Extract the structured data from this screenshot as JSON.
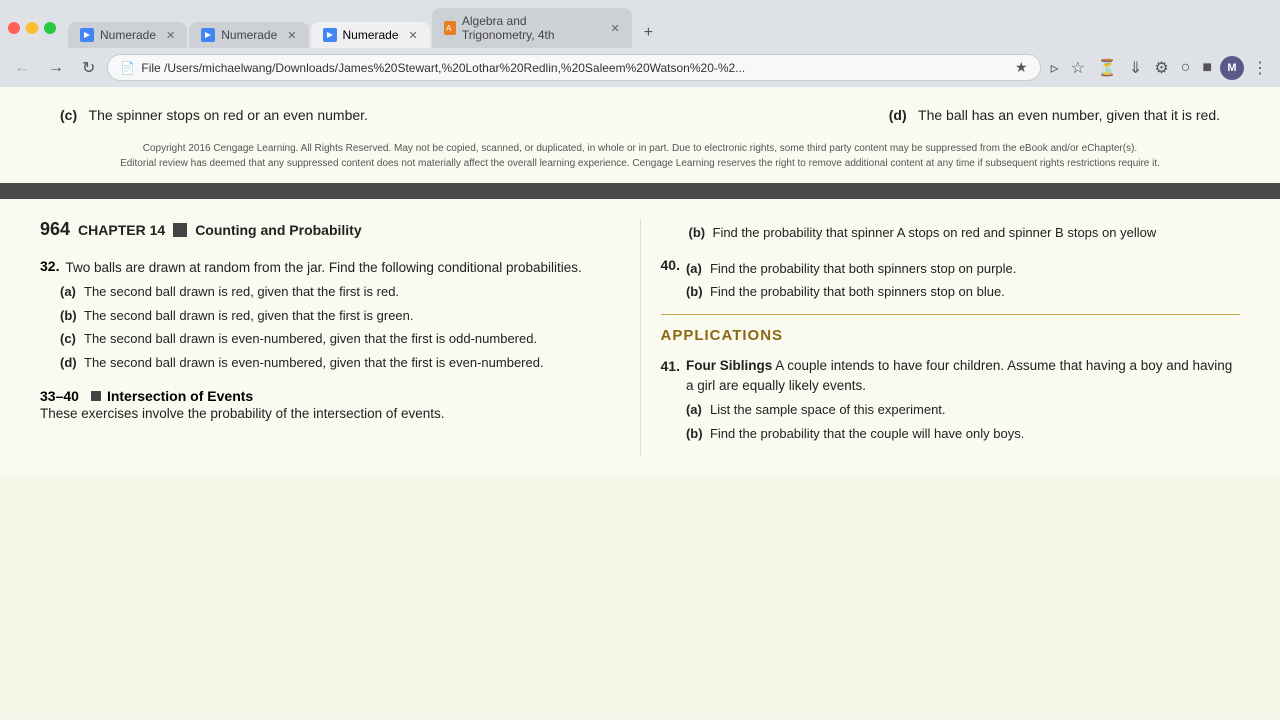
{
  "browser": {
    "tabs": [
      {
        "label": "Numerade",
        "active": false,
        "icon": "N"
      },
      {
        "label": "Numerade",
        "active": false,
        "icon": "N"
      },
      {
        "label": "Numerade",
        "active": true,
        "icon": "N"
      },
      {
        "label": "Algebra and Trigonometry, 4th",
        "active": false,
        "icon": "A"
      }
    ],
    "address": "File  /Users/michaelwang/Downloads/James%20Stewart,%20Lothar%20Redlin,%20Saleem%20Watson%20-%2...",
    "profile_initials": "M"
  },
  "top_section": {
    "left": {
      "label": "(c)",
      "text": "The spinner stops on red or an even number."
    },
    "right": {
      "label": "(d)",
      "text": "The ball has an even number, given that it is red."
    }
  },
  "copyright": {
    "line1": "Copyright 2016 Cengage Learning. All Rights Reserved. May not be copied, scanned, or duplicated, in whole or in part. Due to electronic rights, some third party content may be suppressed from the eBook and/or eChapter(s).",
    "line2": "Editorial review has deemed that any suppressed content does not materially affect the overall learning experience. Cengage Learning reserves the right to remove additional content at any time if subsequent rights restrictions require it."
  },
  "chapter_header": {
    "page": "964",
    "chapter": "CHAPTER 14",
    "title": "Counting and Probability"
  },
  "q32": {
    "number": "32.",
    "text": "Two balls are drawn at random from the jar. Find the following conditional probabilities.",
    "parts": [
      {
        "label": "(a)",
        "text": "The second ball drawn is red, given that the first is red."
      },
      {
        "label": "(b)",
        "text": "The second ball drawn is red, given that the first is green."
      },
      {
        "label": "(c)",
        "text": "The second ball drawn is even-numbered, given that the first is odd-numbered."
      },
      {
        "label": "(d)",
        "text": "The second ball drawn is even-numbered, given that the first is even-numbered."
      }
    ]
  },
  "section3340": {
    "range": "33–40",
    "title": "Intersection of Events",
    "text": "These exercises involve the probability of the intersection of events."
  },
  "right_column": {
    "q39_b": {
      "number": "",
      "label": "(b)",
      "text": "Find the probability that spinner A stops on red and spinner B stops on yellow"
    },
    "q40": {
      "number": "40.",
      "parts": [
        {
          "label": "(a)",
          "text": "Find the probability that both spinners stop on purple."
        },
        {
          "label": "(b)",
          "text": "Find the probability that both spinners stop on blue."
        }
      ]
    },
    "applications_header": "APPLICATIONS",
    "q41": {
      "number": "41.",
      "title": "Four Siblings",
      "intro": "A couple intends to have four children. Assume that having a boy and having a girl are equally likely events.",
      "parts": [
        {
          "label": "(a)",
          "text": "List the sample space of this experiment."
        },
        {
          "label": "(b)",
          "text": "Find the probability that the couple will have only boys."
        }
      ]
    }
  }
}
